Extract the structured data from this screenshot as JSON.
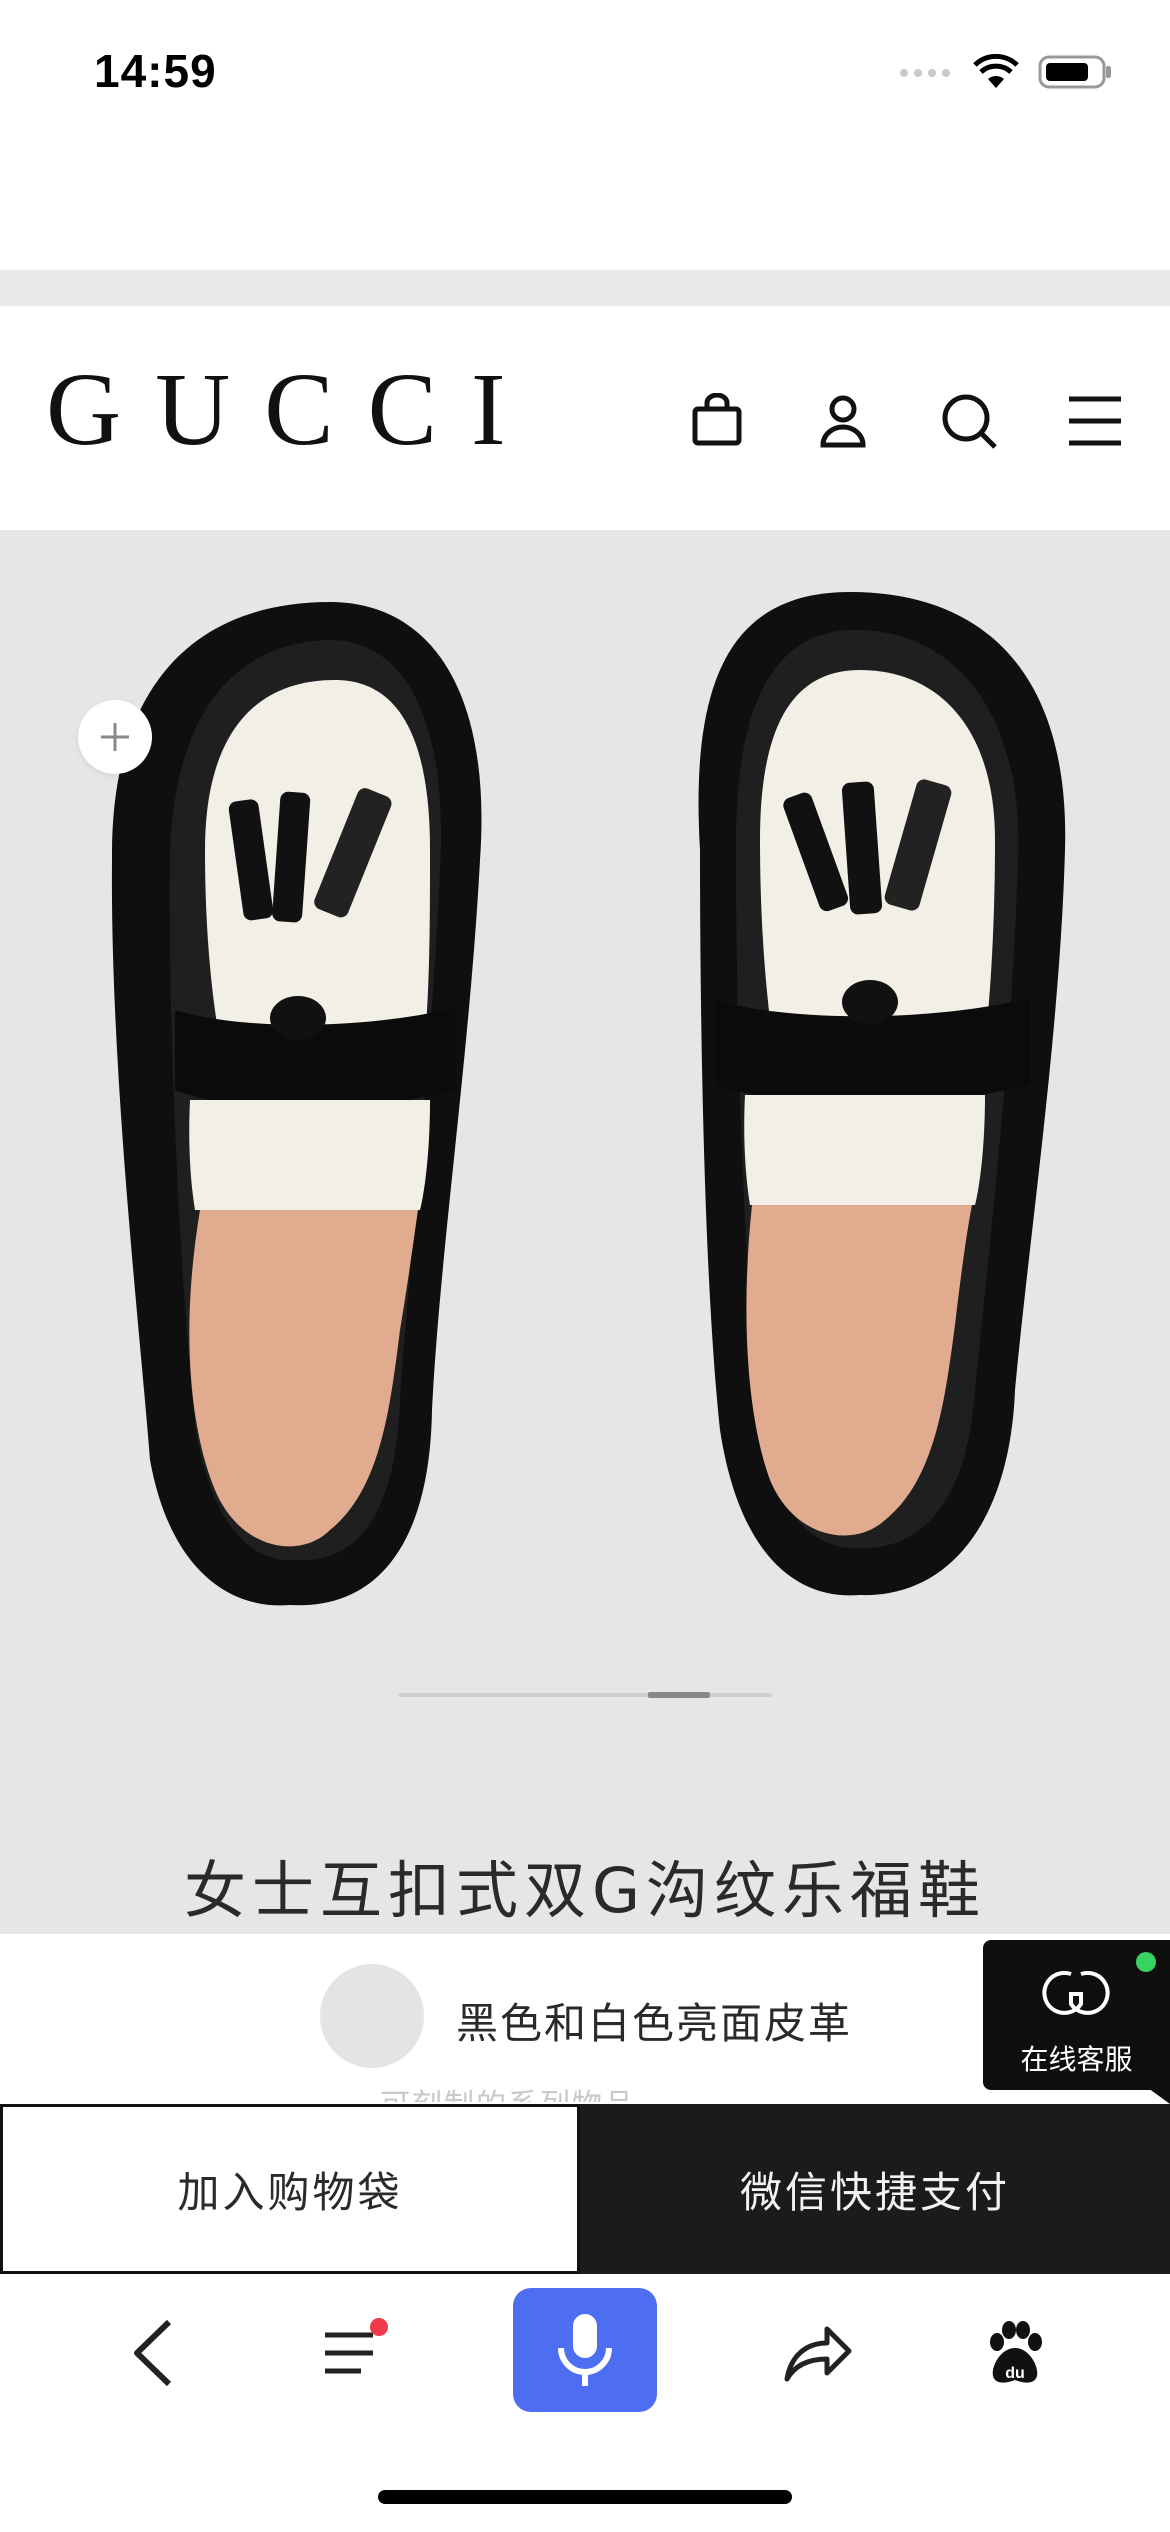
{
  "status_bar": {
    "time": "14:59"
  },
  "header": {
    "brand": "GUCCI"
  },
  "product": {
    "title": "女士互扣式双G沟纹乐福鞋",
    "variant": "黑色和白色亮面皮革",
    "variant_sub": "可刻制的系列物品"
  },
  "chat": {
    "label": "在线客服"
  },
  "actions": {
    "add_to_bag": "加入购物袋",
    "wechat_pay": "微信快捷支付"
  },
  "icons": {
    "bag": "shopping-bag-icon",
    "account": "user-icon",
    "search": "search-icon",
    "menu": "hamburger-menu-icon",
    "zoom": "plus-icon",
    "back": "chevron-left-icon",
    "list": "list-icon",
    "mic": "microphone-icon",
    "share": "share-icon",
    "baidu": "baidu-paw-icon"
  },
  "colors": {
    "browser_accent": "#4e6ef2",
    "notification": "#f0394a",
    "online": "#37d260"
  }
}
